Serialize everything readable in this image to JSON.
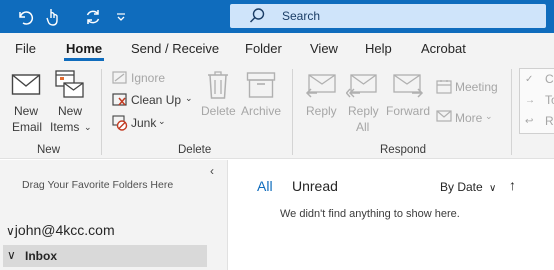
{
  "qat": {
    "icons": [
      "undo-icon",
      "touch-mode-icon",
      "sync-icon",
      "customize-icon"
    ]
  },
  "search": {
    "placeholder": "Search"
  },
  "menu": {
    "tabs": [
      "File",
      "Home",
      "Send / Receive",
      "Folder",
      "View",
      "Help",
      "Acrobat"
    ],
    "active": "Home"
  },
  "ribbon": {
    "new": {
      "new_email_line1": "New",
      "new_email_line2": "Email",
      "new_items_line1": "New",
      "new_items_line2": "Items",
      "group": "New"
    },
    "delete": {
      "ignore": "Ignore",
      "clean_up": "Clean Up",
      "junk": "Junk",
      "delete": "Delete",
      "archive": "Archive",
      "group": "Delete"
    },
    "respond": {
      "reply": "Reply",
      "reply_all_line1": "Reply",
      "reply_all_line2": "All",
      "forward": "Forward",
      "meeting": "Meeting",
      "more": "More",
      "group": "Respond"
    },
    "quick_steps": {
      "item1": "C",
      "item2": "To",
      "item3": "Re"
    }
  },
  "folders": {
    "drag_hint": "Drag Your Favorite Folders Here",
    "account": "john@4kcc.com",
    "inbox": "Inbox"
  },
  "mail_list": {
    "tab_all": "All",
    "tab_unread": "Unread",
    "sort": "By Date",
    "empty_message": "We didn't find anything to show here."
  },
  "colors": {
    "accent": "#0f6cbd",
    "search_bg": "#cfe4fa",
    "ribbon_bg": "#f3f3f3"
  }
}
